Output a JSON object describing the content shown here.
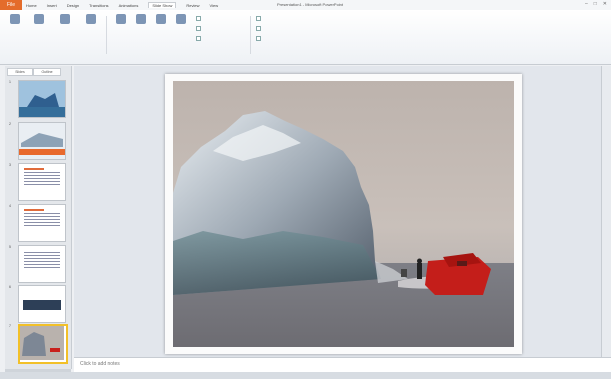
{
  "ribbon_menu": {
    "file": "File",
    "tabs": [
      "Home",
      "Insert",
      "Design",
      "Transitions",
      "Animations",
      "Slide Show",
      "Review",
      "View"
    ],
    "active_tab": "Slide Show"
  },
  "window": {
    "title": "Presentation1 - Microsoft PowerPoint"
  },
  "slide_panel": {
    "tabs": [
      "Slides",
      "Outline"
    ],
    "thumb_numbers": [
      "1",
      "2",
      "3",
      "4",
      "5",
      "6",
      "7"
    ]
  },
  "notes": {
    "placeholder": "Click to add notes"
  }
}
